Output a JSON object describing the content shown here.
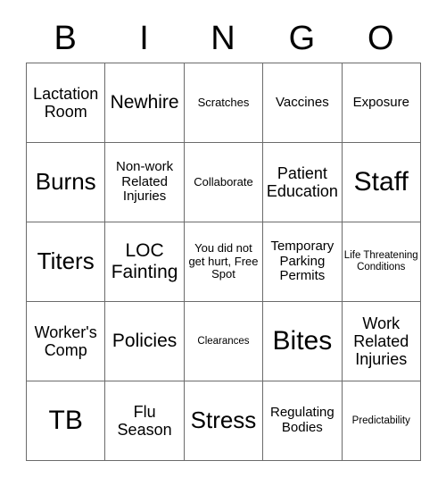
{
  "card": {
    "header_letters": [
      "B",
      "I",
      "N",
      "G",
      "O"
    ],
    "rows": [
      [
        {
          "text": "Lactation Room",
          "size": "m"
        },
        {
          "text": "Newhire",
          "size": "l"
        },
        {
          "text": "Scratches",
          "size": "xs"
        },
        {
          "text": "Vaccines",
          "size": "s"
        },
        {
          "text": "Exposure",
          "size": "s"
        }
      ],
      [
        {
          "text": "Burns",
          "size": "xl"
        },
        {
          "text": "Non-work Related Injuries",
          "size": "s"
        },
        {
          "text": "Collaborate",
          "size": "xs"
        },
        {
          "text": "Patient Education",
          "size": "m"
        },
        {
          "text": "Staff",
          "size": "xxl"
        }
      ],
      [
        {
          "text": "Titers",
          "size": "xl"
        },
        {
          "text": "LOC Fainting",
          "size": "l"
        },
        {
          "text": "You did not get hurt, Free Spot",
          "size": "xs"
        },
        {
          "text": "Temporary Parking Permits",
          "size": "s"
        },
        {
          "text": "Life Threatening Conditions",
          "size": "xxs"
        }
      ],
      [
        {
          "text": "Worker's Comp",
          "size": "m"
        },
        {
          "text": "Policies",
          "size": "l"
        },
        {
          "text": "Clearances",
          "size": "xxs"
        },
        {
          "text": "Bites",
          "size": "xxl"
        },
        {
          "text": "Work Related Injuries",
          "size": "m"
        }
      ],
      [
        {
          "text": "TB",
          "size": "xxl"
        },
        {
          "text": "Flu Season",
          "size": "m"
        },
        {
          "text": "Stress",
          "size": "xl"
        },
        {
          "text": "Regulating Bodies",
          "size": "s"
        },
        {
          "text": "Predictability",
          "size": "xxs"
        }
      ]
    ],
    "colors": {
      "border": "#6b6b6b",
      "text": "#000000",
      "background": "#ffffff"
    }
  }
}
